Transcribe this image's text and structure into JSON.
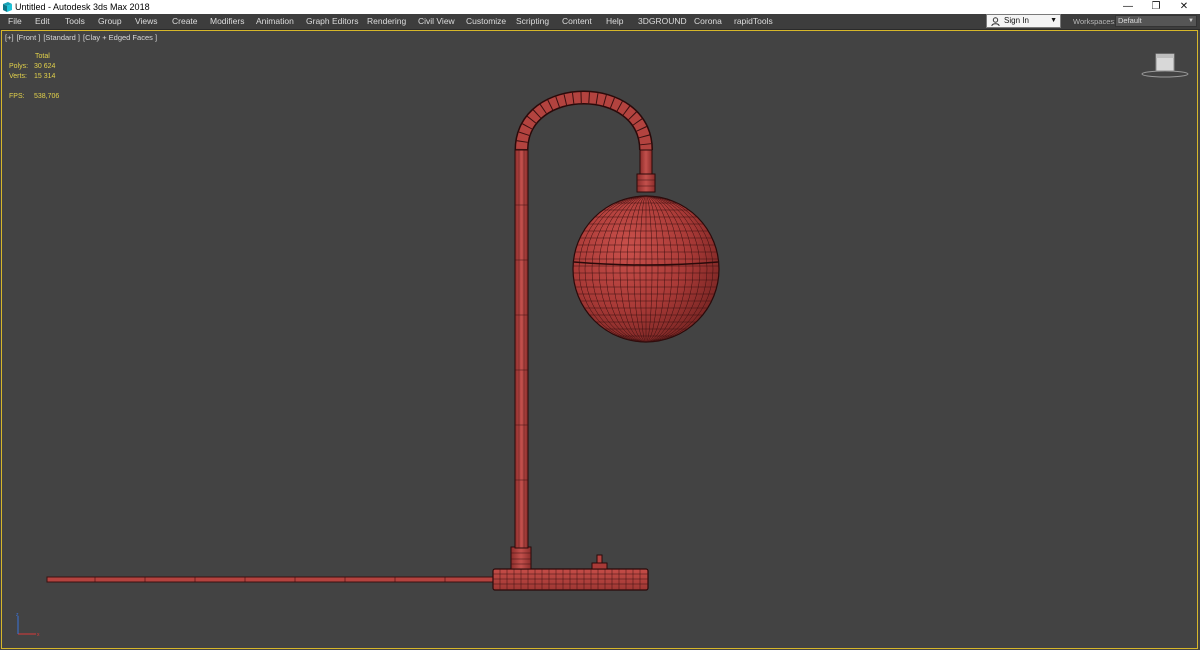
{
  "window": {
    "title": "Untitled - Autodesk 3ds Max 2018"
  },
  "menu": {
    "items": [
      "File",
      "Edit",
      "Tools",
      "Group",
      "Views",
      "Create",
      "Modifiers",
      "Animation",
      "Graph Editors",
      "Rendering",
      "Civil View",
      "Customize",
      "Scripting",
      "Content",
      "Help",
      "3DGROUND",
      "Corona",
      "rapidTools"
    ]
  },
  "account": {
    "signin_label": "Sign In",
    "workspaces_label": "Workspaces:",
    "workspace_value": "Default"
  },
  "viewport": {
    "labels": [
      "[+]",
      "[Front ]",
      "[Standard ]",
      "[Clay + Edged Faces ]"
    ]
  },
  "stats": {
    "header": "Total",
    "polys_label": "Polys:",
    "polys_value": "30 624",
    "verts_label": "Verts:",
    "verts_value": "15 314",
    "fps_label": "FPS:",
    "fps_value": "538,706"
  },
  "colors": {
    "viewport_border": "#d7b72a",
    "stats_text": "#e4d34b",
    "model_fill": "#b8413e",
    "wire": "#3a1010"
  },
  "icons": {
    "app": "3dsmax-logo-icon",
    "user": "user-icon",
    "dropdown": "chevron-down-icon",
    "viewcube": "viewcube-icon",
    "axis": "axis-tripod-icon"
  }
}
